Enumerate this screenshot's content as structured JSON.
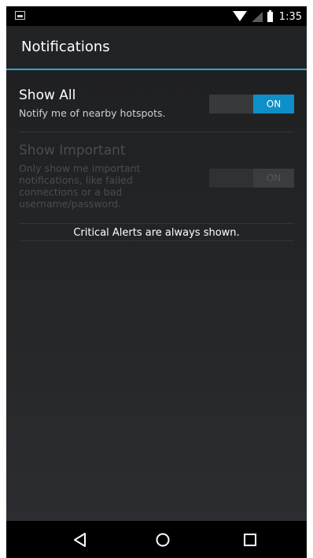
{
  "status_bar": {
    "time": "1:35",
    "icons": [
      "image-notification-icon",
      "wifi-icon",
      "cell-signal-icon",
      "battery-icon"
    ]
  },
  "action_bar": {
    "title": "Notifications"
  },
  "settings": [
    {
      "title": "Show All",
      "summary": "Notify me of nearby hotspots.",
      "toggle_label": "ON",
      "enabled": true
    },
    {
      "title": "Show Important",
      "summary": "Only show me important notifications, like failed connections or a bad username/password.",
      "toggle_label": "ON",
      "enabled": false
    }
  ],
  "footer_note": "Critical Alerts are always shown.",
  "nav_bar": {
    "buttons": [
      "back",
      "home",
      "recents"
    ]
  },
  "colors": {
    "accent": "#33a6cc",
    "toggle_on": "#0e8fc7",
    "background": "#1f2022"
  }
}
